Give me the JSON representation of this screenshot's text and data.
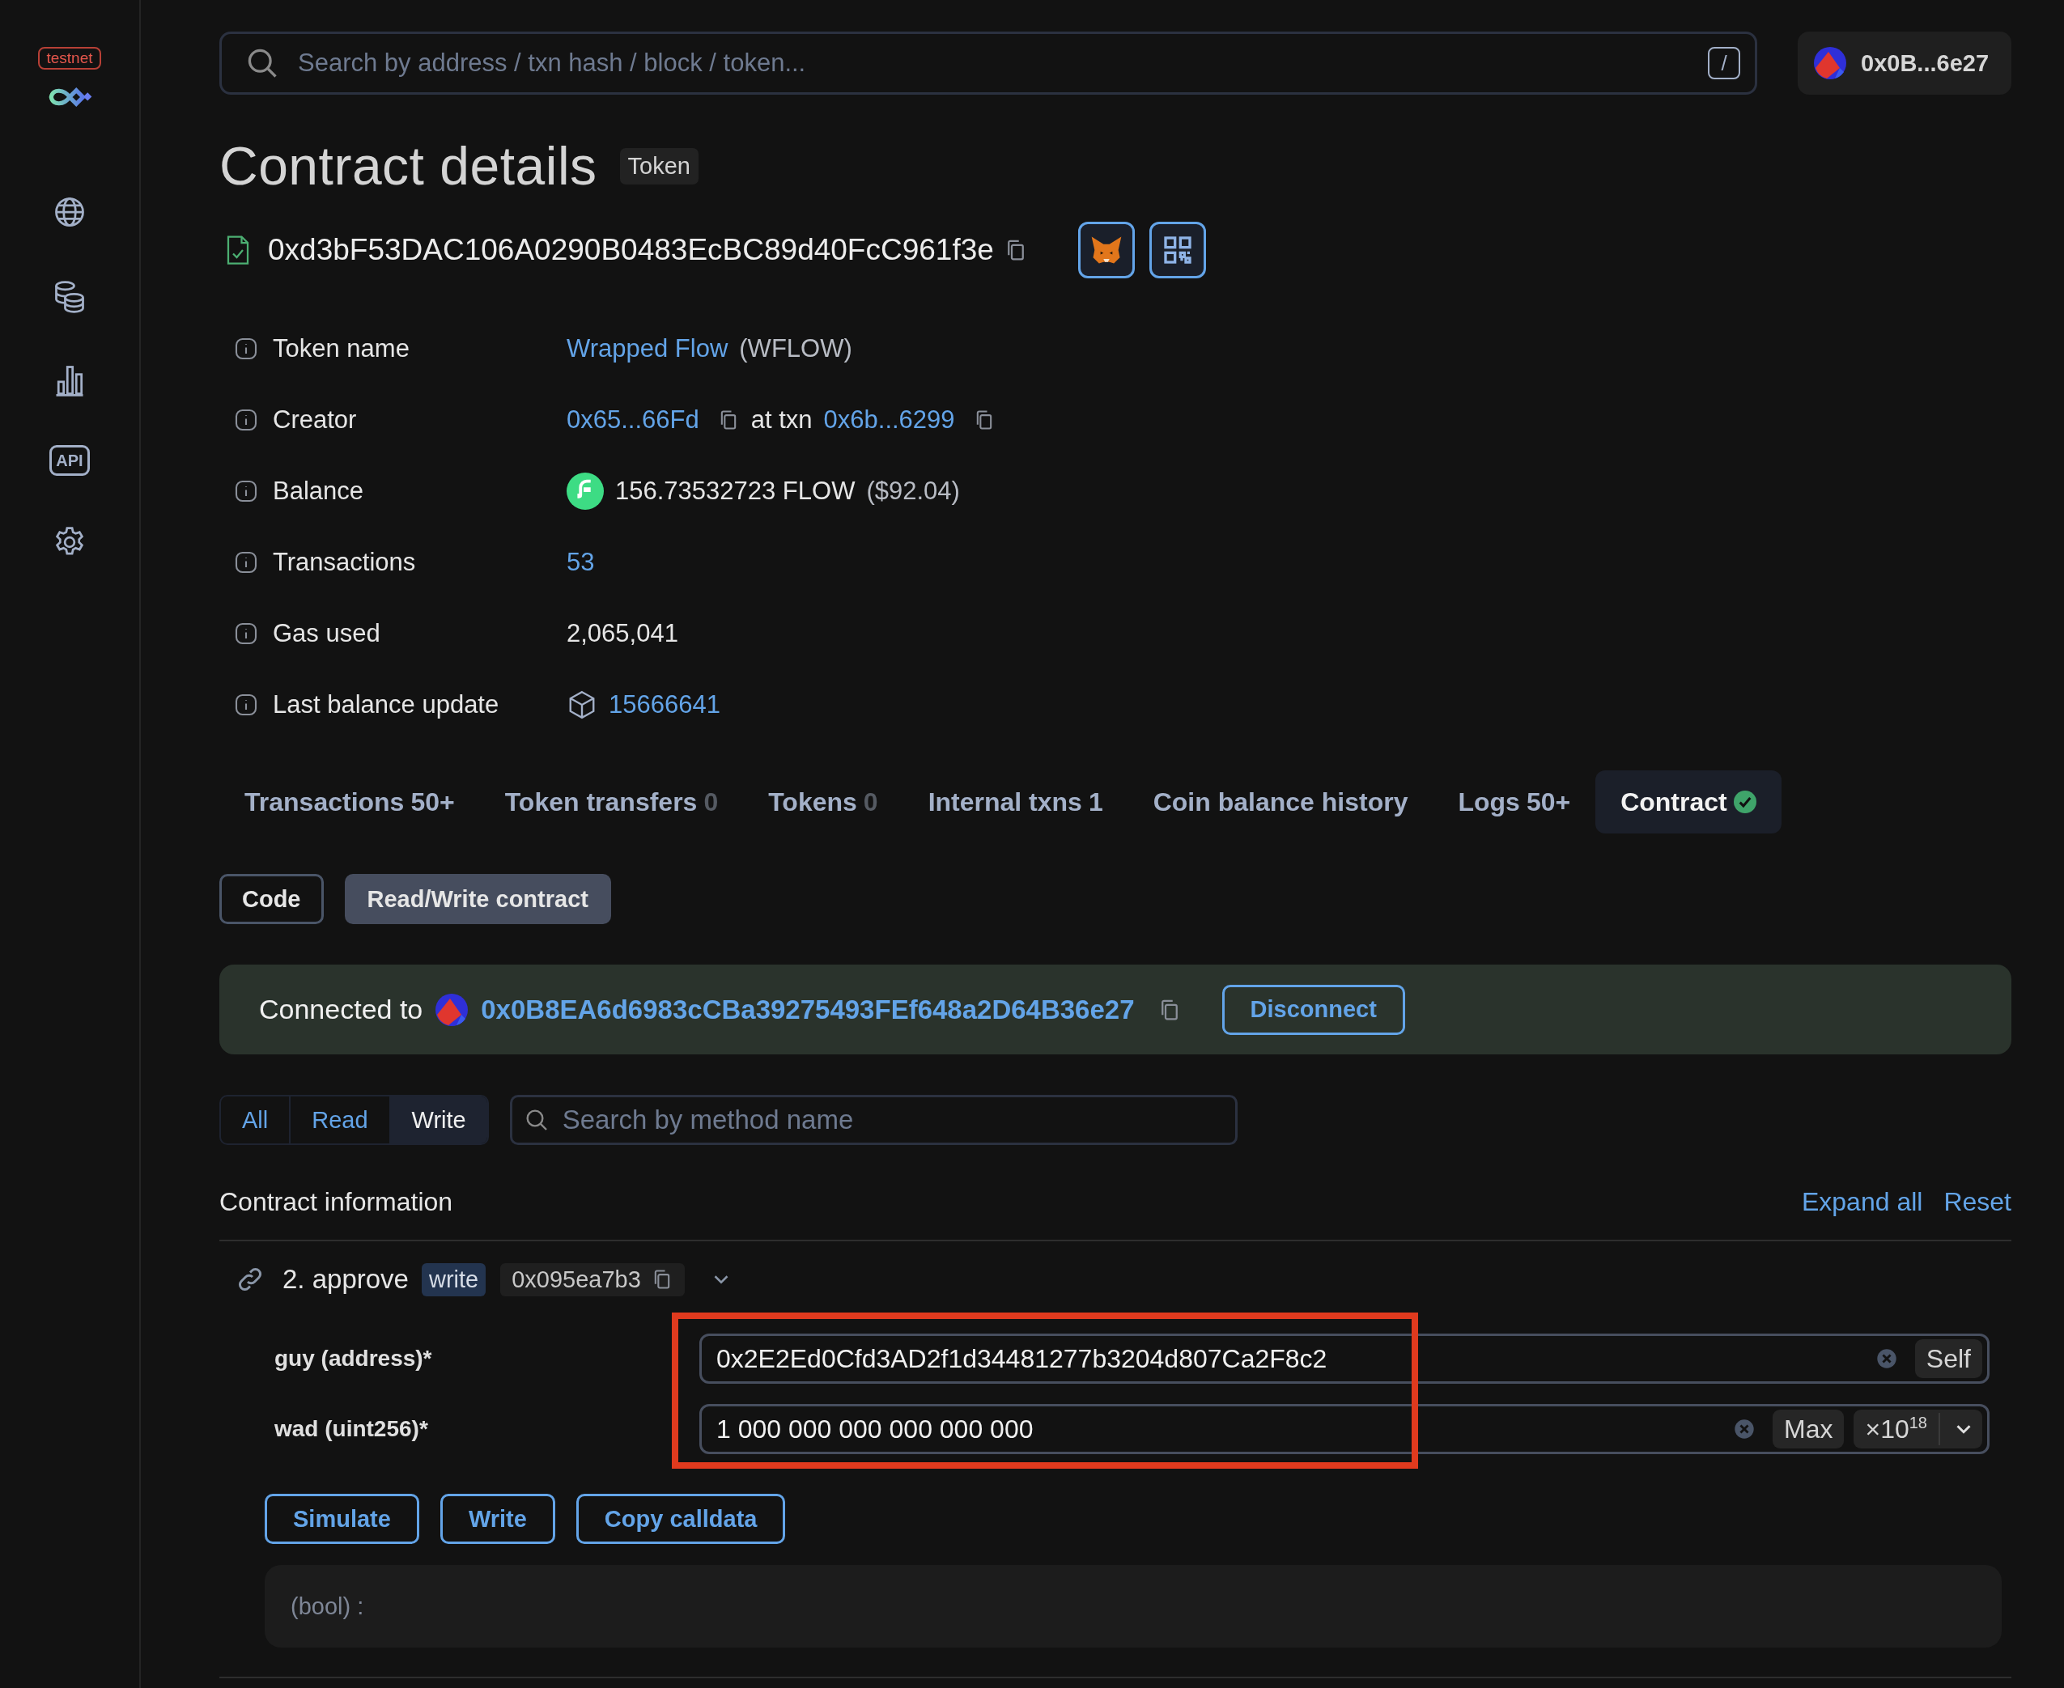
{
  "sidebar": {
    "badge": "testnet",
    "api_label": "API"
  },
  "search": {
    "placeholder": "Search by address / txn hash / block / token...",
    "shortcut": "/"
  },
  "account": {
    "address": "0x0B...6e27"
  },
  "page": {
    "title": "Contract details",
    "tag": "Token",
    "address": "0xd3bF53DAC106A0290B0483EcBC89d40FcC961f3e"
  },
  "details": [
    {
      "label": "Token name",
      "kind": "token",
      "value": "Wrapped Flow",
      "suffix": "(WFLOW)"
    },
    {
      "label": "Creator",
      "kind": "creator",
      "value": "0x65...66Fd",
      "middle": "at txn",
      "value2": "0x6b...6299"
    },
    {
      "label": "Balance",
      "kind": "balance",
      "value": "156.73532723 FLOW",
      "suffix": "($92.04)"
    },
    {
      "label": "Transactions",
      "kind": "link",
      "value": "53"
    },
    {
      "label": "Gas used",
      "kind": "text",
      "value": "2,065,041"
    },
    {
      "label": "Last balance update",
      "kind": "block",
      "value": "15666641"
    }
  ],
  "tabs": [
    {
      "label": "Transactions",
      "count": "50+",
      "count_dim": false,
      "selected": false
    },
    {
      "label": "Token transfers",
      "count": "0",
      "count_dim": true,
      "selected": false
    },
    {
      "label": "Tokens",
      "count": "0",
      "count_dim": true,
      "selected": false
    },
    {
      "label": "Internal txns",
      "count": "1",
      "count_dim": false,
      "selected": false
    },
    {
      "label": "Coin balance history",
      "selected": false
    },
    {
      "label": "Logs",
      "count": "50+",
      "count_dim": false,
      "selected": false
    },
    {
      "label": "Contract",
      "verified": true,
      "selected": true
    }
  ],
  "view_buttons": [
    {
      "label": "Code",
      "selected": false
    },
    {
      "label": "Read/Write contract",
      "selected": true
    }
  ],
  "connection": {
    "label": "Connected to",
    "address": "0x0B8EA6d6983cCBa39275493FEf648a2D64B36e27",
    "button": "Disconnect"
  },
  "filters": [
    {
      "label": "All",
      "selected": false
    },
    {
      "label": "Read",
      "selected": false
    },
    {
      "label": "Write",
      "selected": true
    }
  ],
  "method_search": {
    "placeholder": "Search by method name"
  },
  "section": {
    "title": "Contract information",
    "actions": [
      "Expand all",
      "Reset"
    ]
  },
  "method": {
    "name": "2. approve",
    "type": "write",
    "selector": "0x095ea7b3",
    "expanded": true,
    "inputs": [
      {
        "label": "guy (address)*",
        "kind": "address",
        "value": "0x2E2Ed0Cfd3AD2f1d34481277b3204d807Ca2F8c2",
        "button": "Self"
      },
      {
        "label": "wad (uint256)*",
        "kind": "amount",
        "value": "1 000 000 000 000 000 000",
        "button": "Max",
        "multiplier": "×10$^{18}$"
      }
    ],
    "actions": [
      "Simulate",
      "Write",
      "Copy calldata"
    ],
    "output": "(bool) :"
  }
}
